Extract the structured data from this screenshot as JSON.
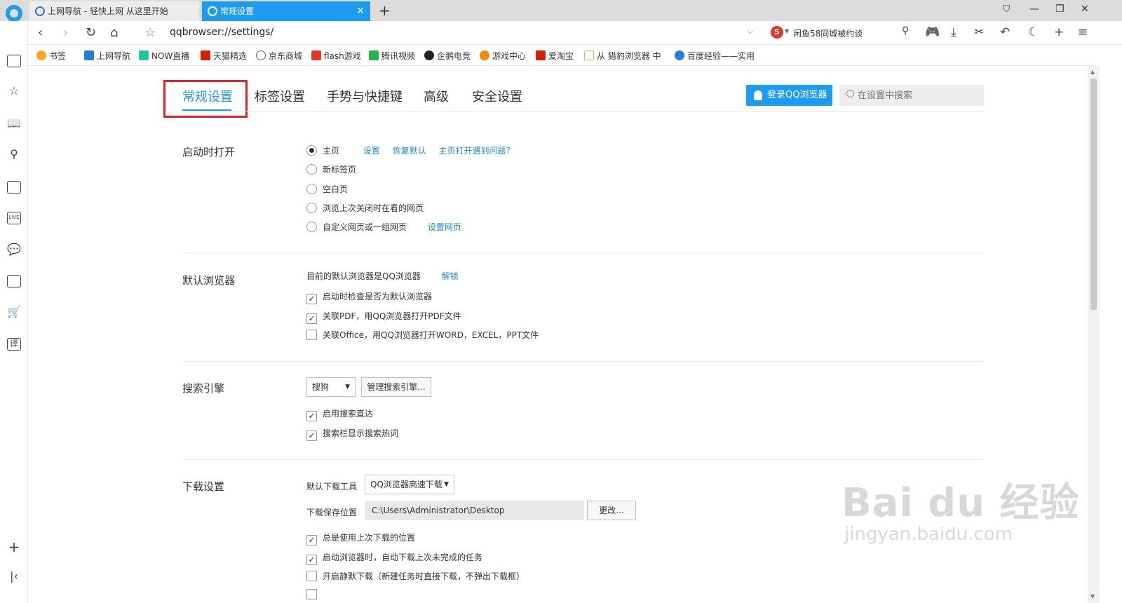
{
  "tabs": [
    {
      "label": "上网导航 - 轻快上网 从这里开始"
    },
    {
      "label": "常规设置"
    }
  ],
  "address": {
    "url": "qqbrowser://settings/"
  },
  "search": {
    "hint": "闲鱼58同城被约谈"
  },
  "bookmarks": [
    "书签",
    "上网导航",
    "NOW直播",
    "天猫精选",
    "京东商城",
    "flash游戏",
    "腾讯视频",
    "企鹅电竞",
    "游戏中心",
    "爱淘宝",
    "从 猎豹浏览器 中",
    "百度经验——实用"
  ],
  "settings_tabs": [
    "常规设置",
    "标签设置",
    "手势与快捷键",
    "高级",
    "安全设置"
  ],
  "login_label": "登录QQ浏览器",
  "settings_search_placeholder": "在设置中搜索",
  "startup": {
    "title": "启动时打开",
    "options": [
      "主页",
      "新标签页",
      "空白页",
      "浏览上次关闭时在看的网页",
      "自定义网页或一组网页"
    ],
    "selected": 0,
    "links": {
      "set": "设置",
      "restore": "恢复默认",
      "problem": "主页打开遇到问题？",
      "set_pages": "设置网页"
    }
  },
  "default_browser": {
    "title": "默认浏览器",
    "status": "目前的默认浏览器是QQ浏览器",
    "unlock": "解锁",
    "checks": [
      {
        "label": "启动时检查是否为默认浏览器",
        "checked": true
      },
      {
        "label": "关联PDF，用QQ浏览器打开PDF文件",
        "checked": true
      },
      {
        "label": "关联Office，用QQ浏览器打开WORD，EXCEL，PPT文件",
        "checked": false
      }
    ]
  },
  "search_engine": {
    "title": "搜索引擎",
    "engine": "搜狗",
    "manage": "管理搜索引擎...",
    "checks": [
      {
        "label": "启用搜索直达",
        "checked": true
      },
      {
        "label": "搜索栏显示搜索热词",
        "checked": true
      }
    ]
  },
  "download": {
    "title": "下载设置",
    "tool_label": "默认下载工具",
    "tool": "QQ浏览器高速下载",
    "path_label": "下载保存位置",
    "path": "C:\\Users\\Administrator\\Desktop",
    "change": "更改...",
    "checks": [
      {
        "label": "总是使用上次下载的位置",
        "checked": true
      },
      {
        "label": "启动浏览器时，自动下载上次未完成的任务",
        "checked": true
      },
      {
        "label": "开启静默下载（新建任务时直接下载，不弹出下载框）",
        "checked": false
      }
    ]
  },
  "watermark": {
    "main": "Bai du 经验",
    "sub": "jingyan.baidu.com"
  },
  "colors": {
    "accent": "#1d9bf0",
    "highlight": "#e0252b",
    "link": "#1d86d6"
  }
}
